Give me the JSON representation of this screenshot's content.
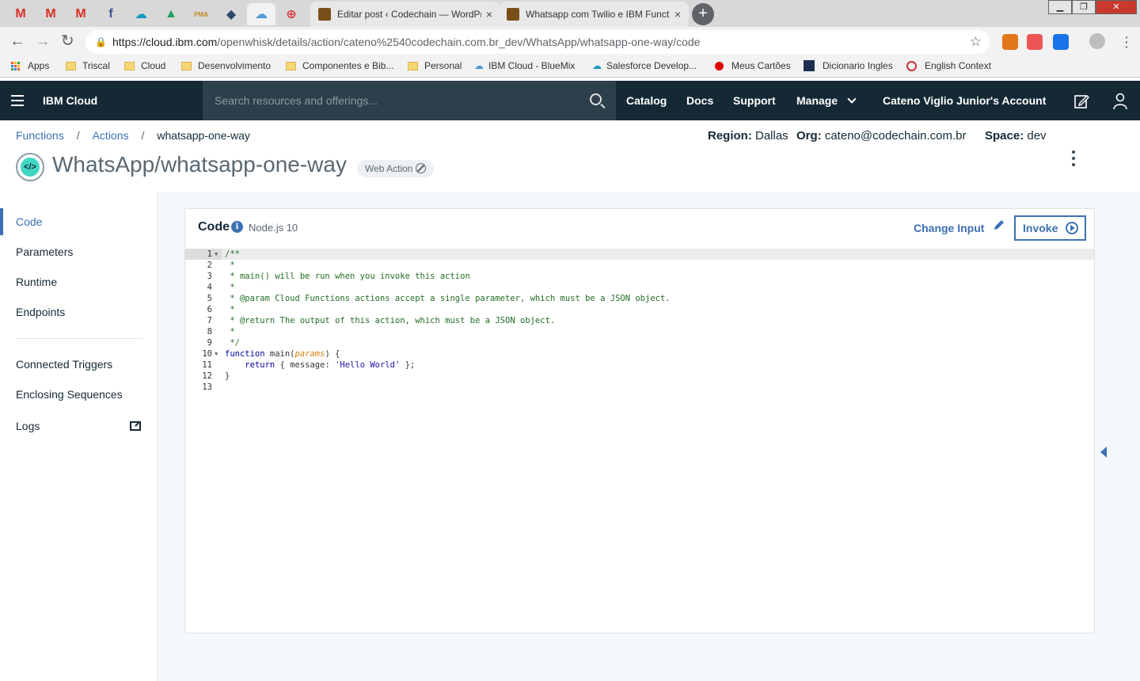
{
  "browser": {
    "pinned_tabs": [
      {
        "icon": "gmail-icon",
        "glyph": "M",
        "color": "#d93025"
      },
      {
        "icon": "gmail-icon",
        "glyph": "M",
        "color": "#d93025"
      },
      {
        "icon": "gmail-icon",
        "glyph": "M",
        "color": "#d93025"
      },
      {
        "icon": "facebook-icon",
        "glyph": "f",
        "color": "#3b5998"
      },
      {
        "icon": "salesforce-icon",
        "glyph": "☁",
        "color": "#1798c1"
      },
      {
        "icon": "drive-icon",
        "glyph": "▲",
        "color": "#1fa463"
      },
      {
        "icon": "pma-icon",
        "glyph": "PMA",
        "color": "#c28a23"
      },
      {
        "icon": "tool-icon",
        "glyph": "◆",
        "color": "#2c4a6b"
      },
      {
        "icon": "ibm-cloud-icon",
        "glyph": "☁",
        "color": "#4c9ad6"
      },
      {
        "icon": "lifebuoy-icon",
        "glyph": "⊕",
        "color": "#d83b3b"
      }
    ],
    "tabs": [
      {
        "title": "Editar post ‹ Codechain — WordPress",
        "close": "×"
      },
      {
        "title": "Whatsapp com Twilio e IBM Functions",
        "close": "×"
      }
    ],
    "new_tab": "+",
    "window_buttons": [
      "▁",
      "❐",
      "✕"
    ],
    "nav": {
      "back": "←",
      "forward": "→",
      "reload": "↻"
    },
    "url_host": "https://cloud.ibm.com",
    "url_path": "/openwhisk/details/action/cateno%2540codechain.com.br_dev/WhatsApp/whatsapp-one-way/code",
    "lock": "🔒",
    "star": "☆",
    "extensions": [
      {
        "icon": "metamask-icon",
        "color": "#e2761b"
      },
      {
        "icon": "share-icon",
        "color": "#e55"
      },
      {
        "icon": "sync-icon",
        "color": "#1a73e8"
      }
    ],
    "menu": "⋮",
    "bookmarks": [
      {
        "label": "Apps",
        "icon": "apps-grid-icon"
      },
      {
        "label": "Triscal",
        "icon": "folder-icon"
      },
      {
        "label": "Cloud",
        "icon": "folder-icon"
      },
      {
        "label": "Desenvolvimento",
        "icon": "folder-icon"
      },
      {
        "label": "Componentes e Bib...",
        "icon": "folder-icon"
      },
      {
        "label": "Personal",
        "icon": "folder-icon"
      },
      {
        "label": "IBM Cloud - BlueMix",
        "icon": "ibm-cloud-icon"
      },
      {
        "label": "Salesforce Develop...",
        "icon": "salesforce-icon"
      },
      {
        "label": "Meus Cartões",
        "icon": "red-dot-icon"
      },
      {
        "label": "Dicionario Ingles",
        "icon": "dictionary-icon"
      },
      {
        "label": "English Context",
        "icon": "context-icon"
      }
    ]
  },
  "header": {
    "brand": "IBM Cloud",
    "search_placeholder": "Search resources and offerings...",
    "nav": [
      "Catalog",
      "Docs",
      "Support",
      "Manage"
    ],
    "account": "Cateno Viglio Junior's Account"
  },
  "breadcrumb": {
    "items": [
      "Functions",
      "Actions"
    ],
    "current": "whatsapp-one-way",
    "separator": "/"
  },
  "context": {
    "region_label": "Region:",
    "region": "Dallas",
    "org_label": "Org:",
    "org": "cateno@codechain.com.br",
    "space_label": "Space:",
    "space": "dev"
  },
  "title": "WhatsApp/whatsapp-one-way",
  "action_icon_glyph": "</>",
  "badge": "Web Action",
  "sidebar": {
    "items": [
      "Code",
      "Parameters",
      "Runtime",
      "Endpoints"
    ],
    "items2": [
      "Connected Triggers",
      "Enclosing Sequences",
      "Logs"
    ]
  },
  "code_panel": {
    "title": "Code",
    "info": "i",
    "runtime": "Node.js 10",
    "change_input": "Change Input",
    "invoke": "Invoke",
    "lines": [
      "/**",
      " *",
      " * main() will be run when you invoke this action",
      " *",
      " * @param Cloud Functions actions accept a single parameter, which must be a JSON object.",
      " *",
      " * @return The output of this action, which must be a JSON object.",
      " *",
      " */",
      "function main(params) {",
      "\treturn { message: 'Hello World' };",
      "}",
      ""
    ]
  }
}
